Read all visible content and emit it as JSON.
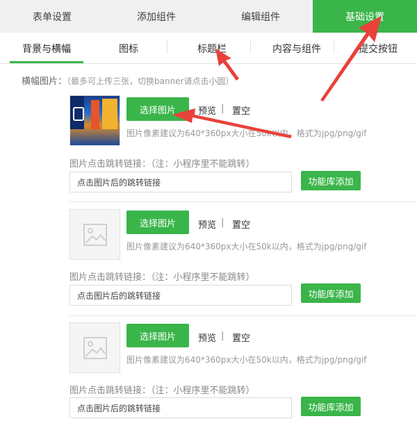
{
  "top_tabs": [
    {
      "label": "表单设置"
    },
    {
      "label": "添加组件"
    },
    {
      "label": "编辑组件"
    },
    {
      "label": "基础设置"
    }
  ],
  "sub_tabs": [
    {
      "label": "背景与横幅"
    },
    {
      "label": "图标"
    },
    {
      "label": "标题栏"
    },
    {
      "label": "内容与组件"
    },
    {
      "label": "提交按钮"
    }
  ],
  "banner": {
    "label": "横幅图片：",
    "hint": "（最多可上传三张，切换banner请点击小圆）"
  },
  "items": [
    {
      "select_label": "选择图片",
      "preview_label": "预览",
      "separator": "|",
      "clear_label": "置空",
      "size_hint": "图片像素建议为640*360px大小在50k以内，格式为jpg/png/gif",
      "link_label": "图片点击跳转链接：（注：小程序里不能跳转）",
      "link_placeholder": "点击图片后的跳转链接",
      "func_label": "功能库添加"
    },
    {
      "select_label": "选择图片",
      "preview_label": "预览",
      "separator": "|",
      "clear_label": "置空",
      "size_hint": "图片像素建议为640*360px大小在50k以内，格式为jpg/png/gif",
      "link_label": "图片点击跳转链接：（注：小程序里不能跳转）",
      "link_placeholder": "点击图片后的跳转链接",
      "func_label": "功能库添加"
    },
    {
      "select_label": "选择图片",
      "preview_label": "预览",
      "separator": "|",
      "clear_label": "置空",
      "size_hint": "图片像素建议为640*360px大小在50k以内，格式为jpg/png/gif",
      "link_label": "图片点击跳转链接：（注：小程序里不能跳转）",
      "link_placeholder": "点击图片后的跳转链接",
      "func_label": "功能库添加"
    }
  ],
  "colors": {
    "accent": "#3ab54a",
    "annotation_arrow": "#e8423a"
  },
  "icons": {
    "empty_thumb": "image-placeholder-icon",
    "arrow": "annotation-arrow-icon"
  }
}
